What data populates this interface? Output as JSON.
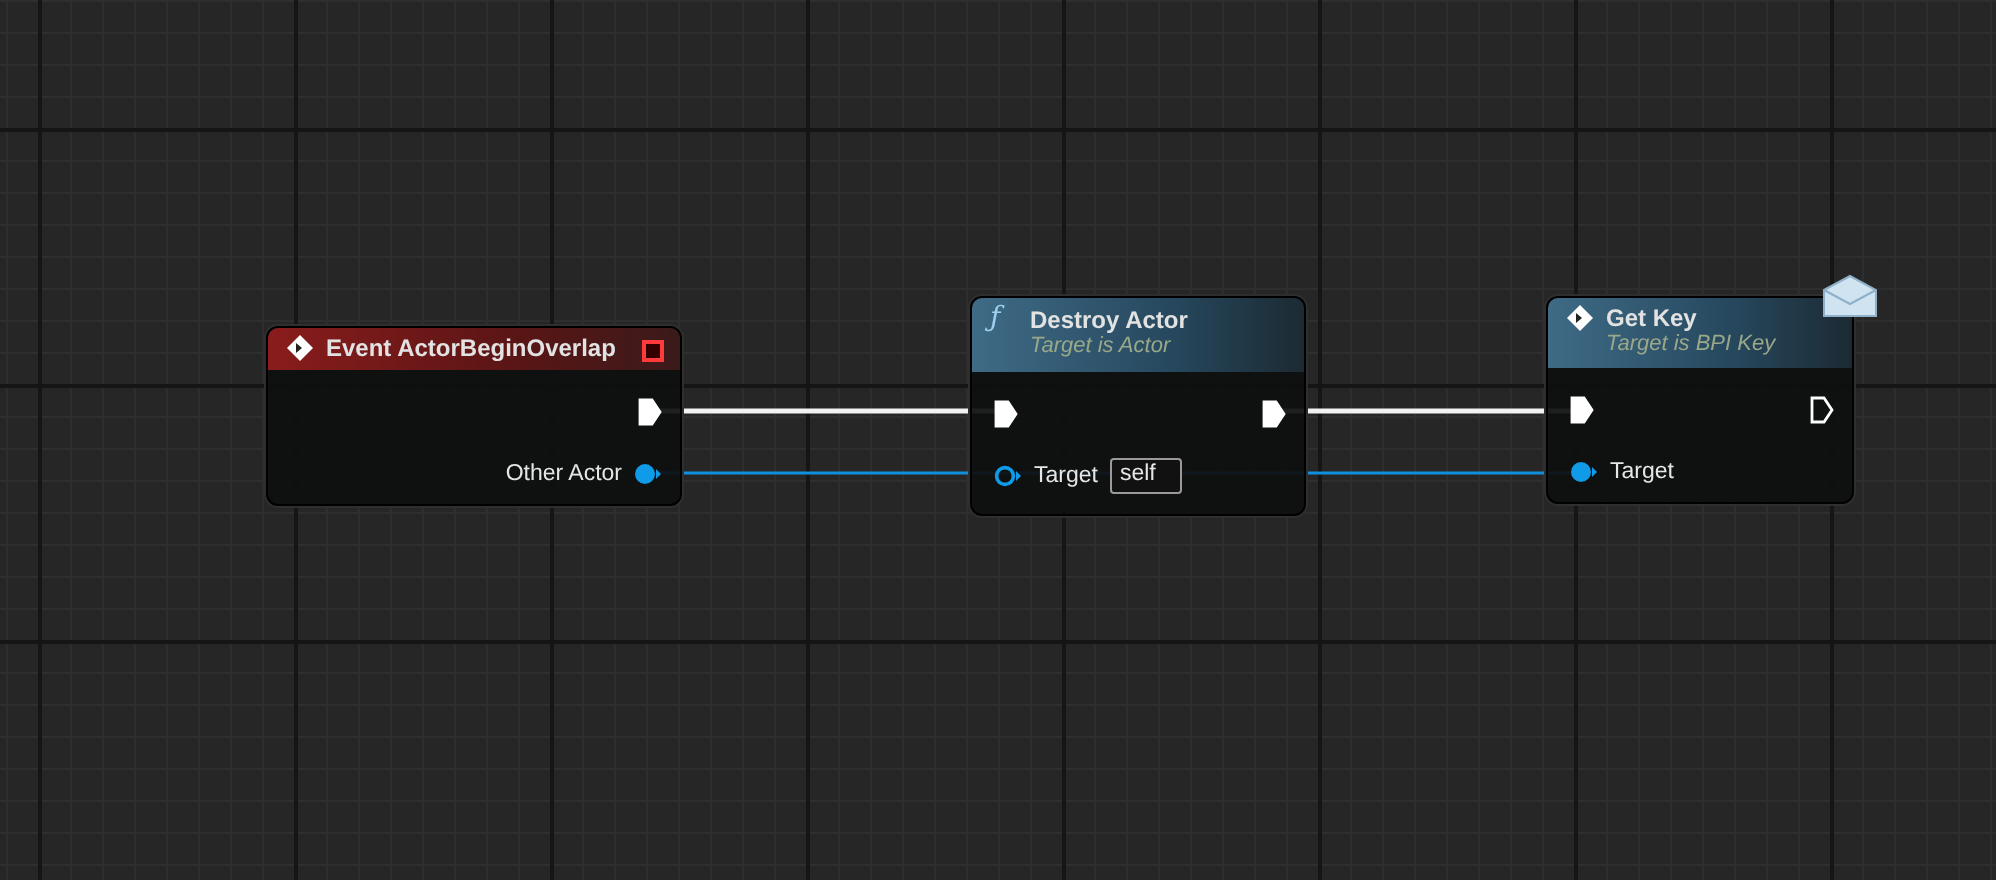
{
  "nodes": [
    {
      "kind": "event",
      "title": "Event ActorBeginOverlap",
      "pins": [
        {
          "kind": "exec_out",
          "connected": true
        },
        {
          "kind": "data_out",
          "label": "Other Actor",
          "connected": true
        }
      ]
    },
    {
      "kind": "function",
      "icon": "ƒ",
      "title": "Destroy Actor",
      "subtitle": "Target is Actor",
      "pins": [
        {
          "kind": "exec_in",
          "connected": true
        },
        {
          "kind": "exec_out",
          "connected": true
        },
        {
          "kind": "data_in",
          "label": "Target",
          "connected": false,
          "default_value": "self"
        }
      ]
    },
    {
      "kind": "message",
      "title": "Get Key",
      "subtitle": "Target is BPI Key",
      "pins": [
        {
          "kind": "exec_in",
          "connected": true
        },
        {
          "kind": "exec_out",
          "connected": false
        },
        {
          "kind": "data_in",
          "label": "Target",
          "connected": true
        }
      ]
    }
  ]
}
